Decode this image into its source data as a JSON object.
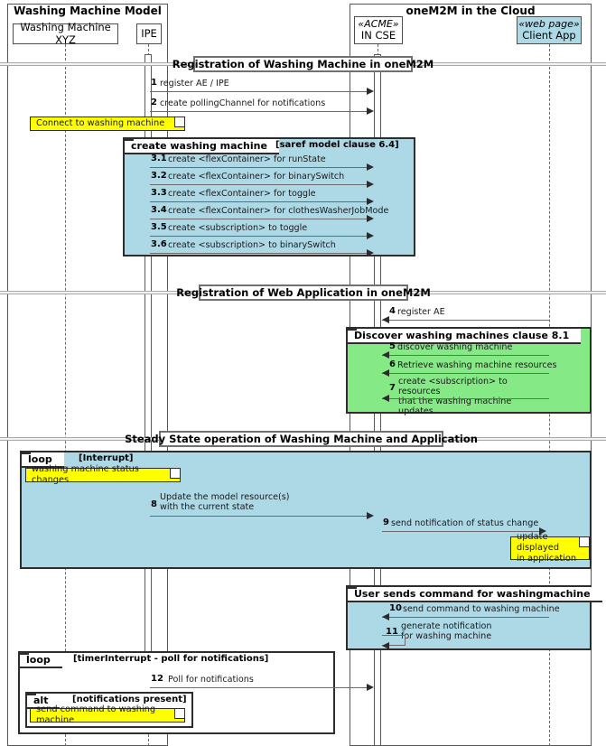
{
  "groups": [
    {
      "title": "Washing Machine Model"
    },
    {
      "title": "oneM2M in the Cloud"
    }
  ],
  "participants": [
    {
      "name": "Washing Machine XYZ",
      "stereotype": ""
    },
    {
      "name": "IPE",
      "stereotype": ""
    },
    {
      "name": "IN CSE",
      "stereotype": "«ACME»"
    },
    {
      "name": "Client App",
      "stereotype": "«web page»"
    }
  ],
  "sections": [
    {
      "label": "Registration of Washing Machine in oneM2M"
    },
    {
      "label": "Registration of Web Application in oneM2M"
    },
    {
      "label": "Steady State operation of Washing Machine and Application"
    }
  ],
  "messages": {
    "m1": {
      "num": "1",
      "text": "register AE / IPE"
    },
    "m2": {
      "num": "2",
      "text": "create pollingChannel for notifications"
    },
    "m31": {
      "num": "3.1",
      "text": "create <flexContainer> for runState"
    },
    "m32": {
      "num": "3.2",
      "text": "create <flexContainer> for binarySwitch"
    },
    "m33": {
      "num": "3.3",
      "text": "create <flexContainer> for toggle"
    },
    "m34": {
      "num": "3.4",
      "text": "create <flexContainer> for clothesWasherJobMode"
    },
    "m35": {
      "num": "3.5",
      "text": "create <subscription> to toggle"
    },
    "m36": {
      "num": "3.6",
      "text": "create <subscription> to binarySwitch"
    },
    "m4": {
      "num": "4",
      "text": "register AE"
    },
    "m5": {
      "num": "5",
      "text": "discover washing machine"
    },
    "m6": {
      "num": "6",
      "text": "Retrieve washing machine resources"
    },
    "m7": {
      "num": "7",
      "text": "create <subscription> to resources\nthat the washing machine updates"
    },
    "m8": {
      "num": "8",
      "text": "Update the model resource(s)\nwith the current state"
    },
    "m9": {
      "num": "9",
      "text": "send notification of status change"
    },
    "m10": {
      "num": "10",
      "text": "send command to washing machine"
    },
    "m11": {
      "num": "11",
      "text": "generate notification\nfor washing machine"
    },
    "m12": {
      "num": "12",
      "text": "Poll for notifications"
    }
  },
  "fragments": {
    "create_wm": {
      "label": "create washing machine",
      "guard": "[saref model clause 6.4]"
    },
    "discover": {
      "label": "Discover washing machines clause 8.1",
      "guard": ""
    },
    "loop_interrupt": {
      "label": "loop",
      "guard": "[Interrupt]"
    },
    "user_command": {
      "label": "User sends command for washingmachine",
      "guard": ""
    },
    "loop_timer": {
      "label": "loop",
      "guard": "[timerInterrupt - poll for notifications]"
    },
    "alt_notifications": {
      "label": "alt",
      "guard": "[notifications present]"
    }
  },
  "notes": {
    "n1": {
      "text": "Connect to washing machine"
    },
    "n2": {
      "text": "washing machine status changes"
    },
    "n3": {
      "text": "update displayed\nin application"
    },
    "n4": {
      "text": "send command to washing machine"
    }
  },
  "colors": {
    "fragment_blue": "#add8e6",
    "fragment_green": "#85e985",
    "note_yellow": "#ffff00",
    "line": "#6b6b6b",
    "border": "#2d2d2d"
  }
}
